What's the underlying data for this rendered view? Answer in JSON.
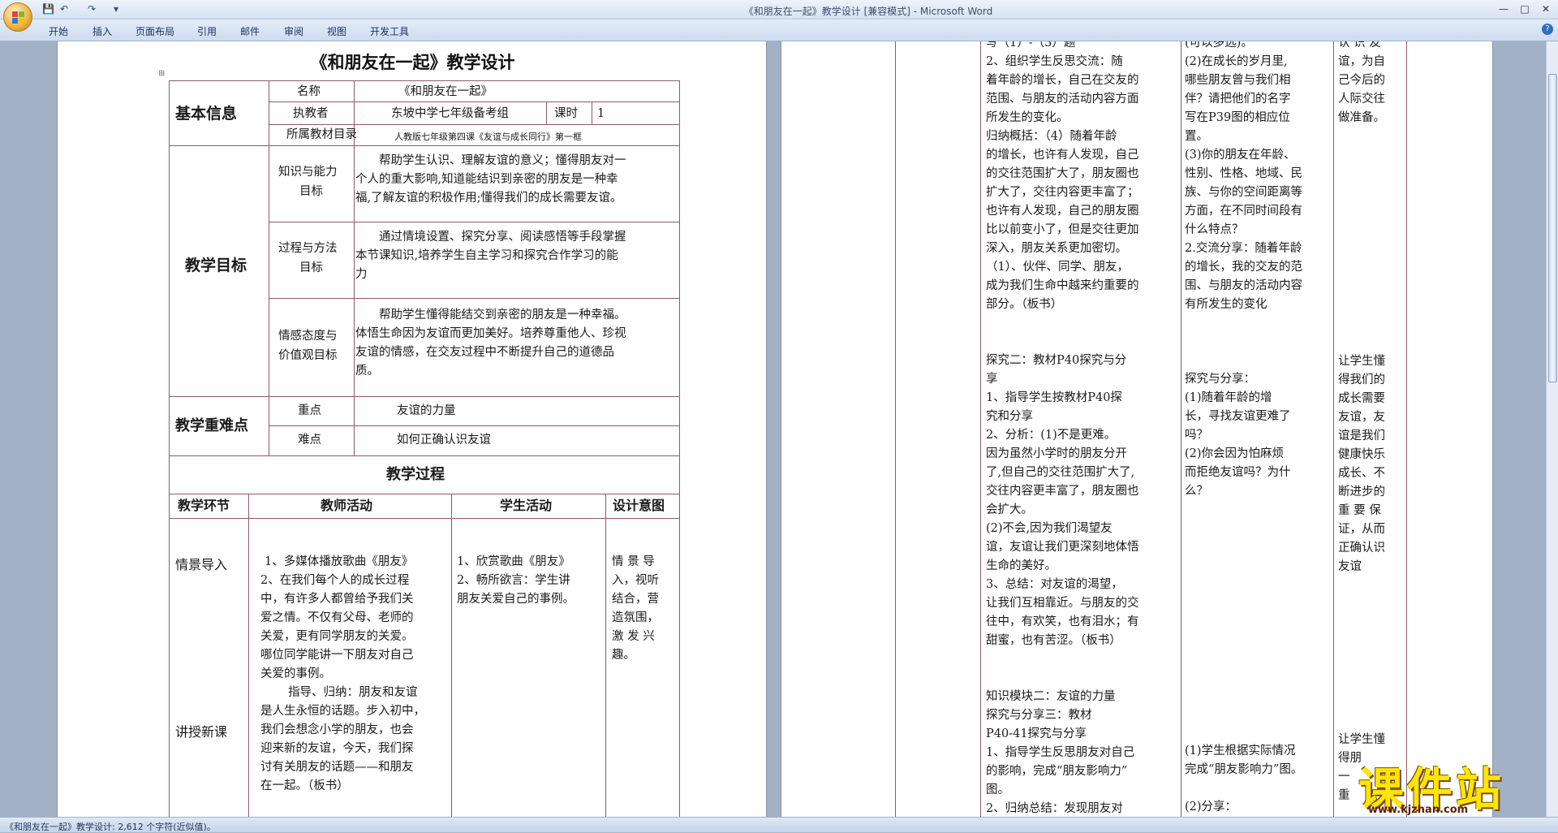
{
  "window": {
    "title": "《和朋友在一起》教学设计 [兼容模式] - Microsoft Word",
    "status_text": "《和朋友在一起》教学设计: 2,612 个字符(近似值)。"
  },
  "qat": {
    "save": "💾",
    "undo": "↶",
    "redo": "↷",
    "more": "▾"
  },
  "window_controls": {
    "min": "—",
    "max": "□",
    "close": "✕",
    "help": "?"
  },
  "ribbon_tabs": [
    "开始",
    "插入",
    "页面布局",
    "引用",
    "邮件",
    "审阅",
    "视图",
    "开发工具"
  ],
  "doc": {
    "title": "《和朋友在一起》教学设计",
    "basic": {
      "label": "基本信息",
      "name_label": "名称",
      "name_value": "《和朋友在一起》",
      "author_label": "执教者",
      "author_value": "东坡中学七年级备考组",
      "period_label": "课时",
      "period_value": "1",
      "textbook_label": "所属教材目录",
      "textbook_value": "人教版七年级第四课《友谊与成长同行》第一框"
    },
    "goals": {
      "label": "教学目标",
      "knowledge_label_1": "知识与能力",
      "knowledge_label_2": "目标",
      "knowledge_lines": [
        "帮助学生认识、理解友谊的意义；懂得朋友对一",
        "个人的重大影响,知道能结识到亲密的朋友是一种幸",
        "福,了解友谊的积极作用;懂得我们的成长需要友谊。"
      ],
      "process_label_1": "过程与方法",
      "process_label_2": "目标",
      "process_lines": [
        "通过情境设置、探究分享、阅读感悟等手段掌握",
        "本节课知识,培养学生自主学习和探究合作学习的能",
        "力"
      ],
      "emotion_label_1": "情感态度与",
      "emotion_label_2": "价值观目标",
      "emotion_lines": [
        "帮助学生懂得能结交到亲密的朋友是一种幸福。",
        "体悟生命因为友谊而更加美好。培养尊重他人、珍视",
        "友谊的情感，在交友过程中不断提升自己的道德品",
        "质。"
      ]
    },
    "keypoints": {
      "label": "教学重难点",
      "key_label": "重点",
      "key_value": "友谊的力量",
      "diff_label": "难点",
      "diff_value": "如何正确认识友谊"
    },
    "process": {
      "title": "教学过程",
      "col_stage": "教学环节",
      "col_teacher": "教师活动",
      "col_student": "学生活动",
      "col_design": "设计意图",
      "stage_1": "情景导入",
      "stage_2": "讲授新课",
      "teacher_lines": [
        "1、多媒体播放歌曲《朋友》",
        "2、在我们每个人的成长过程",
        "中，有许多人都曾给予我们关",
        "爱之情。不仅有父母、老师的",
        "关爱，更有同学朋友的关爱。",
        "哪位同学能讲一下朋友对自己",
        "关爱的事例。",
        "指导、归纳：朋友和友谊",
        "是人生永恒的话题。步入初中，",
        "我们会想念小学的朋友，也会",
        "迎来新的友谊，今天，我们探",
        "讨有关朋友的话题——和朋友",
        "在一起。（板书）"
      ],
      "student_lines": [
        "1、欣赏歌曲《朋友》",
        "2、畅所欲言：学生讲",
        "朋友关爱自己的事例。"
      ],
      "design_lines": [
        "情 景 导",
        "入，视听",
        "结合，营",
        "造氛围，",
        "激 发 兴",
        "趣。"
      ]
    },
    "page2": {
      "teacher_lines": [
        "写（1）-（3）题",
        "2、组织学生反思交流：随",
        "着年龄的增长，自己在交友的",
        "范围、与朋友的活动内容方面",
        "所发生的变化。",
        "归纳概括：（4）随着年龄",
        "的增长，也许有人发现，自己",
        "的交往范围扩大了，朋友圈也",
        "扩大了，交往内容更丰富了；",
        "也许有人发现，自己的朋友圈",
        "比以前变小了，但是交往更加",
        "深入，朋友关系更加密切。",
        "（1）、伙伴、同学、朋友，",
        "成为我们生命中越来约重要的",
        "部分。（板书）",
        "",
        "",
        "探究二：教材P40探究与分",
        "享",
        "1、指导学生按教材P40探",
        "究和分享",
        "2、分析：(1)不是更难。",
        "因为虽然小学时的朋友分开",
        "了,但自己的交往范围扩大了,",
        "交往内容更丰富了，朋友圈也",
        "会扩大。",
        "(2)不会,因为我们渴望友",
        "谊，友谊让我们更深刻地体悟",
        "生命的美好。",
        "3、总结：对友谊的渴望，",
        "让我们互相靠近。与朋友的交",
        "往中，有欢笑，也有泪水；有",
        "甜蜜，也有苦涩。（板书）",
        "",
        "",
        "知识模块二：友谊的力量",
        "探究与分享三：教材",
        "P40-41探究与分享",
        "1、指导学生反思朋友对自己",
        "的影响，完成“朋友影响力”",
        "图。",
        "2、归纳总结：发现朋友对"
      ],
      "student_lines": [
        "(可以多选)。",
        "(2)在成长的岁月里,",
        "哪些朋友曾与我们相",
        "伴？请把他们的名字",
        "写在P39图的相应位",
        "置。",
        "(3)你的朋友在年龄、",
        "性别、性格、地域、民",
        "族、与你的空间距离等",
        "方面，在不同时间段有",
        "什么特点？",
        "2.交流分享：随着年龄",
        "的增长，我的交友的范",
        "围、与朋友的活动内容",
        "有所发生的变化",
        "",
        "",
        "",
        "探究与分享：",
        "(1)随着年龄的增",
        "长，寻找友谊更难了",
        "吗？",
        "(2)你会因为怕麻烦",
        "而拒绝友谊吗？为什",
        "么？"
      ],
      "student_bottom_lines": [
        "(1)学生根据实际情况",
        "完成“朋友影响力”图。",
        "",
        "(2)分享："
      ],
      "design_lines": [
        "认 识 友",
        "谊，为自",
        "己今后的",
        "人际交往",
        "做准备。"
      ],
      "design_lines_2": [
        "让学生懂",
        "得我们的",
        "成长需要",
        "友谊，友",
        "谊是我们",
        "健康快乐",
        "成长、不",
        "断进步的",
        "重 要 保",
        "证，从而",
        "正确认识",
        "友谊"
      ],
      "design_lines_3": [
        "让学生懂",
        "得朋",
        "一",
        "重"
      ]
    }
  },
  "watermark": {
    "text": "课件站",
    "url": "www.kjzhan.com"
  }
}
